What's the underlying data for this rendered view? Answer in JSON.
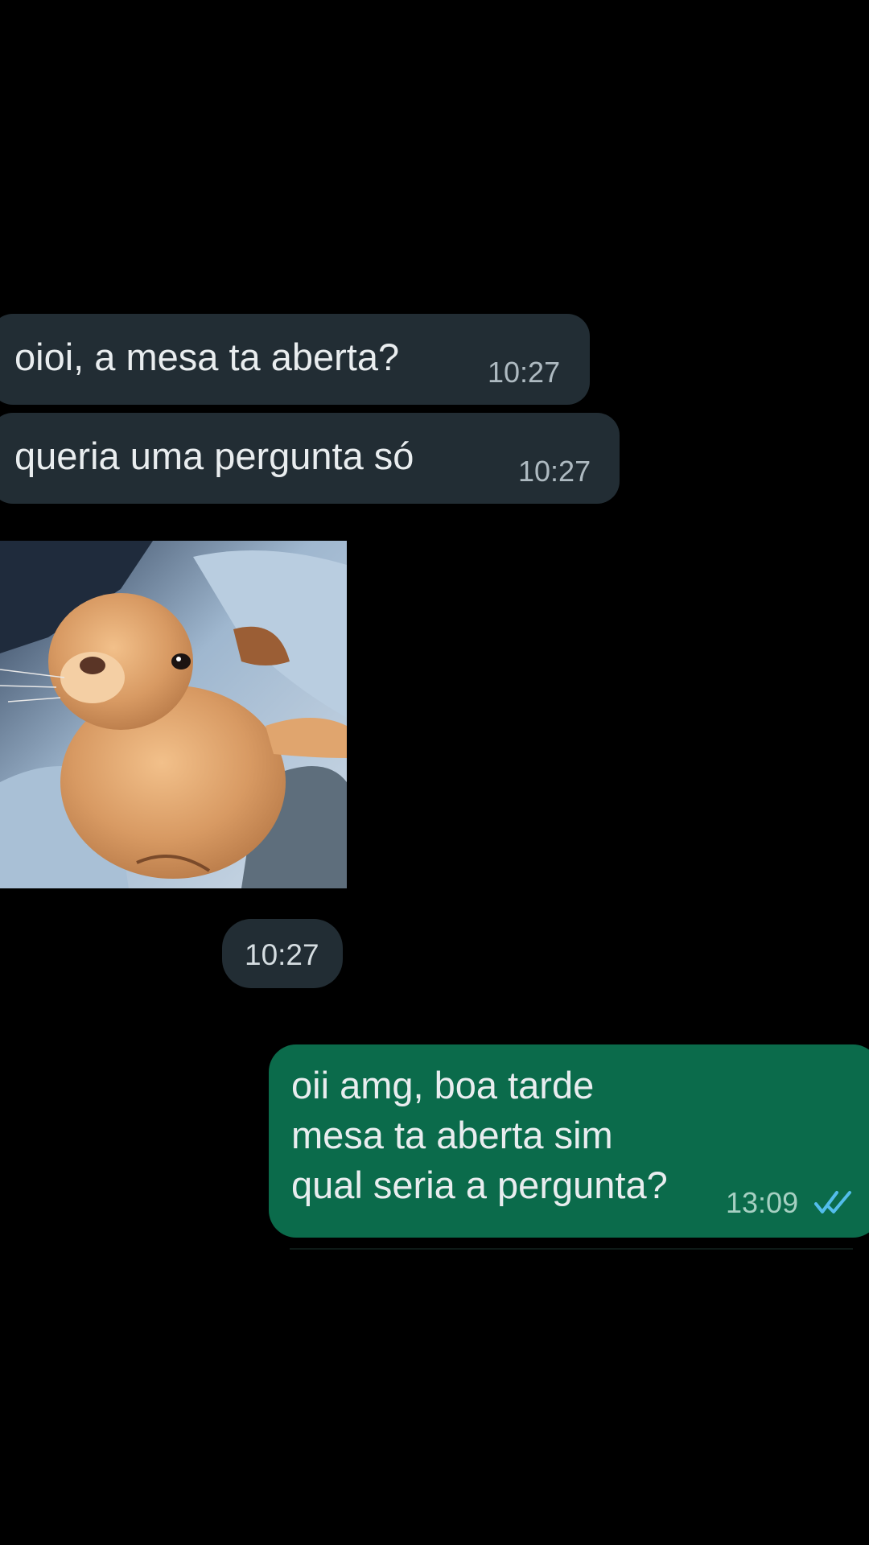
{
  "messages": {
    "incoming": [
      {
        "text": "oioi, a mesa ta aberta?",
        "time": "10:27"
      },
      {
        "text": "queria uma pergunta só",
        "time": "10:27"
      }
    ],
    "image_message": {
      "time": "10:27"
    },
    "outgoing": {
      "lines": [
        "oii amg, boa tarde",
        "mesa ta aberta sim",
        "qual seria a pergunta?"
      ],
      "time": "13:09",
      "status_icon": "double-check-read-icon"
    }
  },
  "colors": {
    "background": "#000000",
    "incoming_bubble": "#222d34",
    "outgoing_bubble": "#0b6b4b",
    "read_ticks": "#53bdeb"
  }
}
